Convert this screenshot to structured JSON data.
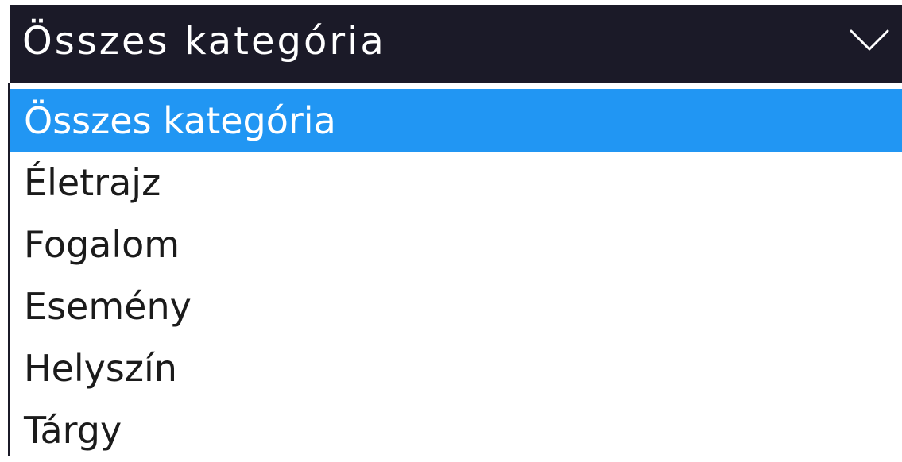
{
  "select": {
    "current_value": "Összes kategória",
    "colors": {
      "box_background": "#1b1a28",
      "highlight": "#2196f3"
    },
    "icon": "chevron-down-icon"
  },
  "options": [
    {
      "label": "Összes kategória",
      "selected": true
    },
    {
      "label": "Életrajz",
      "selected": false
    },
    {
      "label": "Fogalom",
      "selected": false
    },
    {
      "label": "Esemény",
      "selected": false
    },
    {
      "label": "Helyszín",
      "selected": false
    },
    {
      "label": "Tárgy",
      "selected": false
    }
  ]
}
